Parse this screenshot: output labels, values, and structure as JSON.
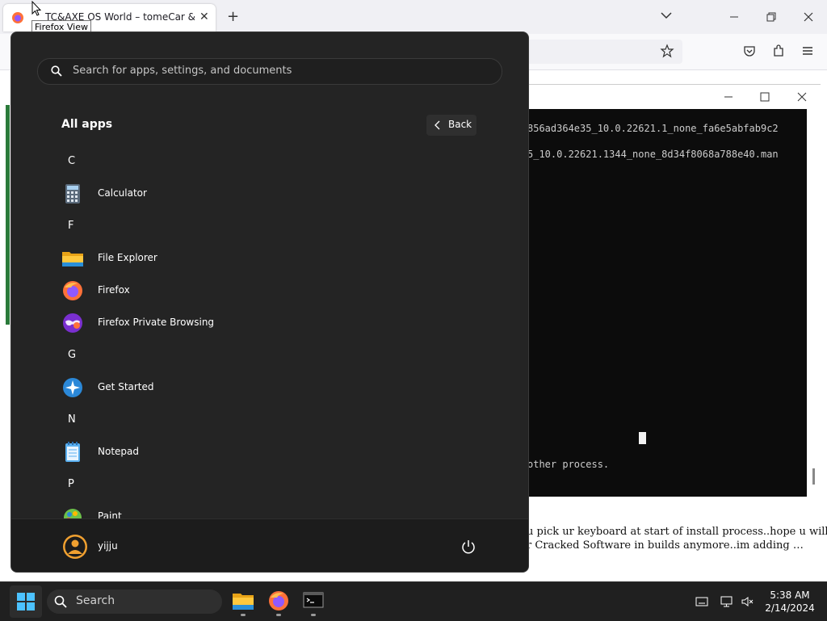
{
  "browser": {
    "tab_title": "TC&AXE OS World – tomeCar & aXe",
    "tooltip": "Firefox View"
  },
  "page": {
    "fragment_line1": "u pick ur keyboard at start of install process..hope u will",
    "fragment_line2": "r Cracked Software in builds anymore..im adding …"
  },
  "terminal": {
    "line1": "856ad364e35_10.0.22621.1_none_fa6e5abfab9c2",
    "line2": "5_10.0.22621.1344_none_8d34f8068a788e40.man",
    "line3": "other process."
  },
  "start_menu": {
    "search_placeholder": "Search for apps, settings, and documents",
    "section_title": "All apps",
    "back_label": "Back",
    "letters": [
      "C",
      "F",
      "G",
      "N",
      "P"
    ],
    "apps": [
      {
        "label": "Calculator",
        "icon": "calculator-icon"
      },
      {
        "label": "File Explorer",
        "icon": "folder-icon"
      },
      {
        "label": "Firefox",
        "icon": "firefox-icon"
      },
      {
        "label": "Firefox Private Browsing",
        "icon": "private-browsing-icon"
      },
      {
        "label": "Get Started",
        "icon": "get-started-icon"
      },
      {
        "label": "Notepad",
        "icon": "notepad-icon"
      },
      {
        "label": "Paint",
        "icon": "paint-icon"
      }
    ],
    "user_name": "yijju"
  },
  "taskbar": {
    "search_label": "Search",
    "time": "5:38 AM",
    "date": "2/14/2024"
  }
}
